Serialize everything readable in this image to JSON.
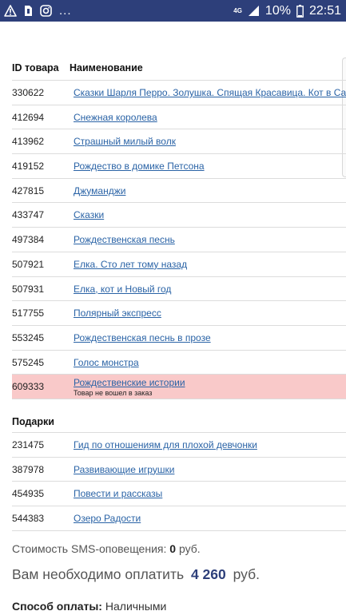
{
  "status_bar": {
    "network_label": "4G",
    "battery": "10%",
    "time": "22:51",
    "dots": "..."
  },
  "table": {
    "col_id": "ID товара",
    "col_name": "Наименование",
    "rows": [
      {
        "id": "330622",
        "name": "Сказки Шарля Перро. Золушка. Спящая Красавица. Кот в Сапогах"
      },
      {
        "id": "412694",
        "name": "Снежная королева"
      },
      {
        "id": "413962",
        "name": "Страшный милый волк"
      },
      {
        "id": "419152",
        "name": "Рождество в домике Петсона"
      },
      {
        "id": "427815",
        "name": "Джуманджи"
      },
      {
        "id": "433747",
        "name": "Сказки"
      },
      {
        "id": "497384",
        "name": "Рождественская песнь"
      },
      {
        "id": "507921",
        "name": "Елка. Сто лет тому назад"
      },
      {
        "id": "507931",
        "name": "Елка, кот и Новый год"
      },
      {
        "id": "517755",
        "name": "Полярный экспресс"
      },
      {
        "id": "553245",
        "name": "Рождественская песнь в прозе"
      },
      {
        "id": "575245",
        "name": "Голос монстра"
      },
      {
        "id": "609333",
        "name": "Рождественские истории",
        "note": "Товар не вошел в заказ"
      }
    ]
  },
  "gifts": {
    "title": "Подарки",
    "rows": [
      {
        "id": "231475",
        "name": "Гид по отношениям для плохой девчонки"
      },
      {
        "id": "387978",
        "name": "Развивающие игрушки"
      },
      {
        "id": "454935",
        "name": "Повести и рассказы"
      },
      {
        "id": "544383",
        "name": "Озеро Радости"
      }
    ]
  },
  "sms": {
    "label": "Стоимость SMS-оповещения:",
    "value": "0",
    "unit": "руб."
  },
  "payment": {
    "label": "Вам необходимо оплатить",
    "amount": "4 260",
    "unit": "руб."
  },
  "method": {
    "label": "Способ оплаты:",
    "value": "Наличными"
  },
  "colors": {
    "status_bar": "#2d3f7a",
    "link": "#2a63a6",
    "highlight": "#f9c9c9"
  }
}
